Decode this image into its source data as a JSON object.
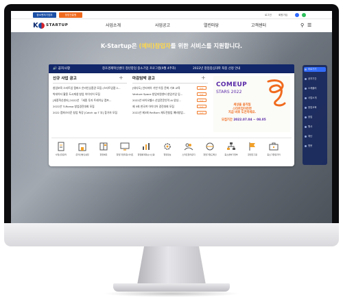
{
  "utility_bar": {
    "gov_label": "중소벤처기업부",
    "agency_label": "창업진흥원",
    "links": [
      "로그인",
      "회원가입"
    ]
  },
  "nav": {
    "logo_k": "K",
    "logo_text": "STARTUP",
    "menu": [
      "사업소개",
      "사업공고",
      "열린마당",
      "고객센터"
    ]
  },
  "hero": {
    "headline_pre": "K-Startup은 ",
    "headline_highlight": "(예비)창업자",
    "headline_post": "를 위한 서비스를 지원합니다."
  },
  "notice": {
    "label": "공지사항",
    "items": [
      "창조경제혁신센터 청년창업 중소기업 프로그램(9월 4주차)",
      "2022년 창업중심대학 최종 선정 안내"
    ]
  },
  "new_programs": {
    "title": "신규 사업 공고",
    "items": [
      "창업보육 스타트업 캠퍼스 온라인상품권 모집 (스타트업랩 2...",
      "빅데이터 활용 도시재생 창업 아이디어 모집",
      "[세종혁신센터] 2022년 「세종 투자 트레이닝 캠프...",
      "2022년 TLRonsa 창업경진대회 모집",
      "2022 캠퍼스타운 창업 특강 [Catch up T 부] 참가자 모집"
    ]
  },
  "deadline_programs": {
    "title": "마감임박 공고",
    "items": [
      {
        "text": "[대다도] 인터미아 기반 이동 문화 기초 교육",
        "tag": "D-1"
      },
      {
        "text": "Venture Space 창업지원센터 창업기업 입...",
        "tag": "D-2"
      },
      {
        "text": "2022년 바이오헬스 산업전문인력 AI 양성...",
        "tag": "D-2"
      },
      {
        "text": "제 5회 한국여 아이디어 경진대회 모집",
        "tag": "D-3"
      },
      {
        "text": "2022년 제3회 Re:Born 재도전창업 예비창업...",
        "tag": "D-3"
      }
    ]
  },
  "banner": {
    "title": "COMEUP",
    "subtitle": "STARS 2022",
    "cta_lines": [
      "세상을 움직일",
      "스타트업이라면",
      "지금 바로 도전하세요."
    ],
    "deadline_label": "모집기간",
    "deadline_value": "2022.07.04 ~ 08.05"
  },
  "quick_links": [
    {
      "label": "사업신청관리",
      "icon": "document-icon"
    },
    {
      "label": "온라인법인설립",
      "icon": "building-icon"
    },
    {
      "label": "창업에듀",
      "icon": "book-icon"
    },
    {
      "label": "창업기업지원사이트",
      "icon": "monitor-icon"
    },
    {
      "label": "창업통계정보시스템",
      "icon": "chart-icon"
    },
    {
      "label": "행정정보",
      "icon": "gear-icon"
    },
    {
      "label": "스타트업라운지",
      "icon": "people-icon"
    },
    {
      "label": "창업기업도메인",
      "icon": "globe-icon"
    },
    {
      "label": "중소벤처기업부",
      "icon": "org-icon"
    },
    {
      "label": "창업진흥원",
      "icon": "flag-icon"
    },
    {
      "label": "중소기업일자리",
      "icon": "briefcase-icon"
    }
  ],
  "sidebar": {
    "items": [
      "바로가기",
      "공지기간",
      "스케줄러",
      "사업소개",
      "창업교육",
      "창업",
      "행사",
      "재난",
      "챗봇"
    ]
  },
  "colors": {
    "navy": "#12276a",
    "orange": "#f06a1d",
    "purple": "#5a2aa8",
    "highlight": "#ffd84a"
  }
}
